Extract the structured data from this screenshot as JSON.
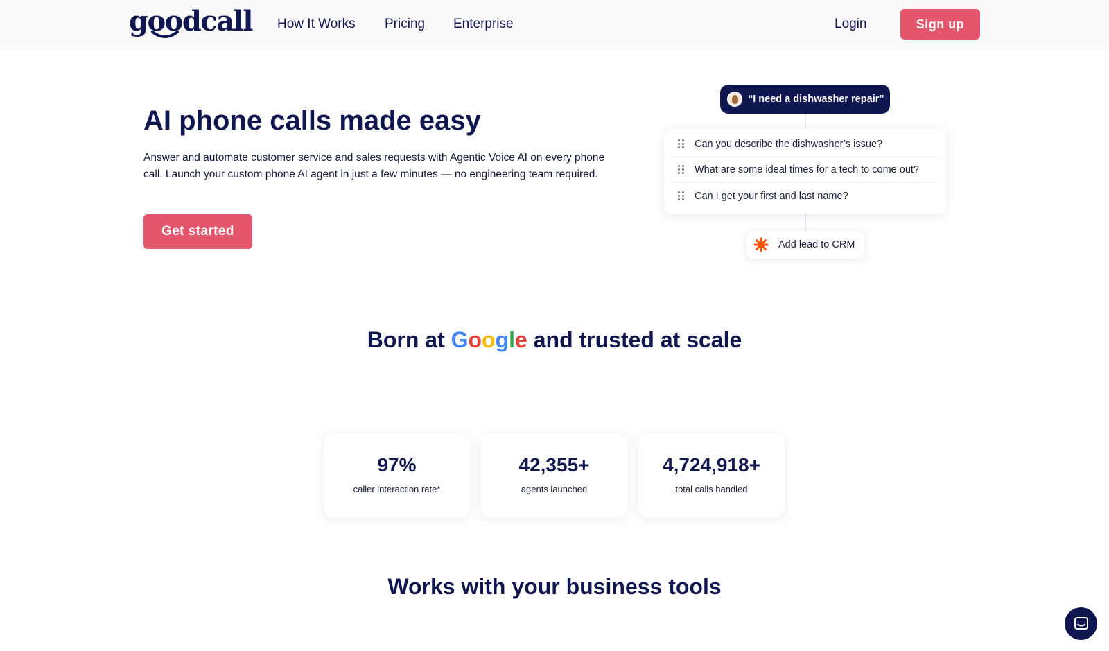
{
  "nav": {
    "logo": "goodcall",
    "links": [
      "How It Works",
      "Pricing",
      "Enterprise"
    ],
    "login": "Login",
    "signup": "Sign up"
  },
  "hero": {
    "title": "AI phone calls made easy",
    "description": "Answer and automate customer service and sales requests with Agentic Voice AI on every phone call. Launch your custom phone AI agent in just a few minutes — no engineering team required.",
    "cta": "Get started"
  },
  "illustration": {
    "quote": "“I need a dishwasher repair”",
    "questions": [
      "Can you describe the dishwasher’s issue?",
      "What are some ideal times for a tech to come out?",
      "Can I get your first and last name?"
    ],
    "crm_action": "Add lead to CRM"
  },
  "trust": {
    "prefix": "Born at ",
    "google": [
      "G",
      "o",
      "o",
      "g",
      "l",
      "e"
    ],
    "suffix": " and trusted at scale"
  },
  "stats": [
    {
      "value": "97%",
      "label": "caller interaction rate*"
    },
    {
      "value": "42,355+",
      "label": "agents launched"
    },
    {
      "value": "4,724,918+",
      "label": "total calls handled"
    }
  ],
  "tools_title": "Works with your business tools",
  "colors": {
    "navy": "#0f1650",
    "accent": "#e5566c",
    "zapier": "#ff4f00",
    "google_blue": "#4285f4",
    "google_red": "#ea4335",
    "google_yellow": "#fbbc05",
    "google_green": "#34a853"
  },
  "icons": {
    "avatar": "caller-avatar",
    "grip": "drag-handle-icon",
    "crm": "zapier-icon",
    "chat": "chat-icon"
  }
}
